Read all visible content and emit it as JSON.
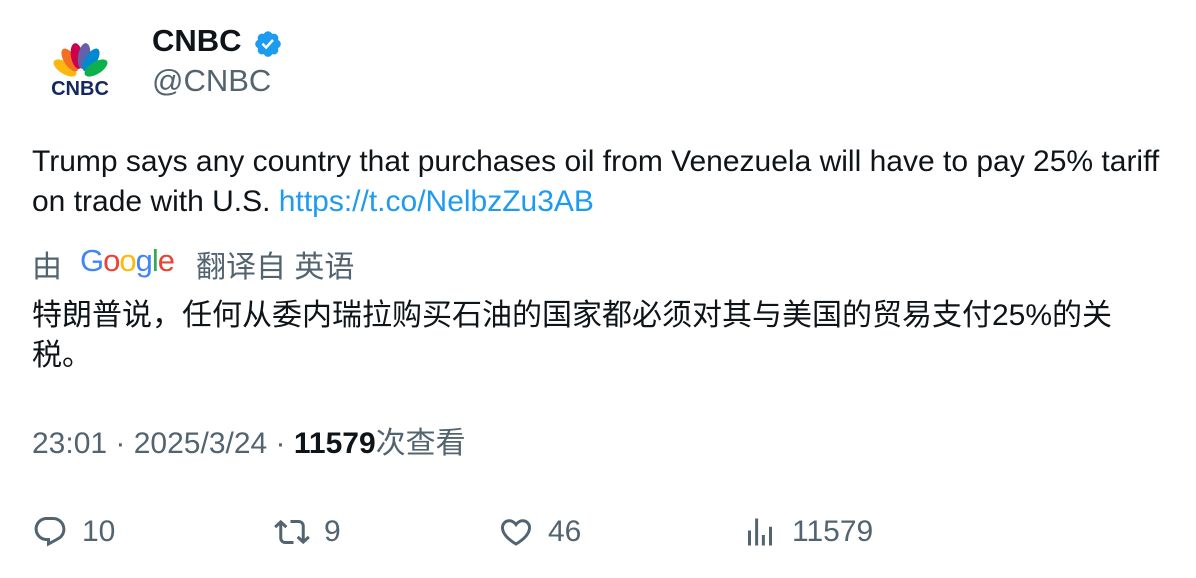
{
  "author": {
    "display_name": "CNBC",
    "handle": "@CNBC",
    "avatar_icon": "cnbc-peacock-logo",
    "avatar_text": "CNBC",
    "verified": true,
    "verified_color": "#1d9bf0"
  },
  "tweet": {
    "text": "Trump says any country that purchases oil from Venezuela will have to pay 25% tariff on trade with U.S.",
    "link": "https://t.co/NelbzZu3AB"
  },
  "translation": {
    "by_label": "由",
    "provider": "Google",
    "from_label": "翻译自 英语",
    "text": "特朗普说，任何从委内瑞拉购买石油的国家都必须对其与美国的贸易支付25%的关税。"
  },
  "meta": {
    "time": "23:01",
    "separator": " · ",
    "date": "2025/3/24",
    "views_count": "11579",
    "views_label": "次查看"
  },
  "actions": {
    "replies": "10",
    "retweets": "9",
    "likes": "46",
    "views": "11579"
  },
  "colors": {
    "text": "#0f1419",
    "secondary": "#536471",
    "link": "#1d9bf0"
  }
}
